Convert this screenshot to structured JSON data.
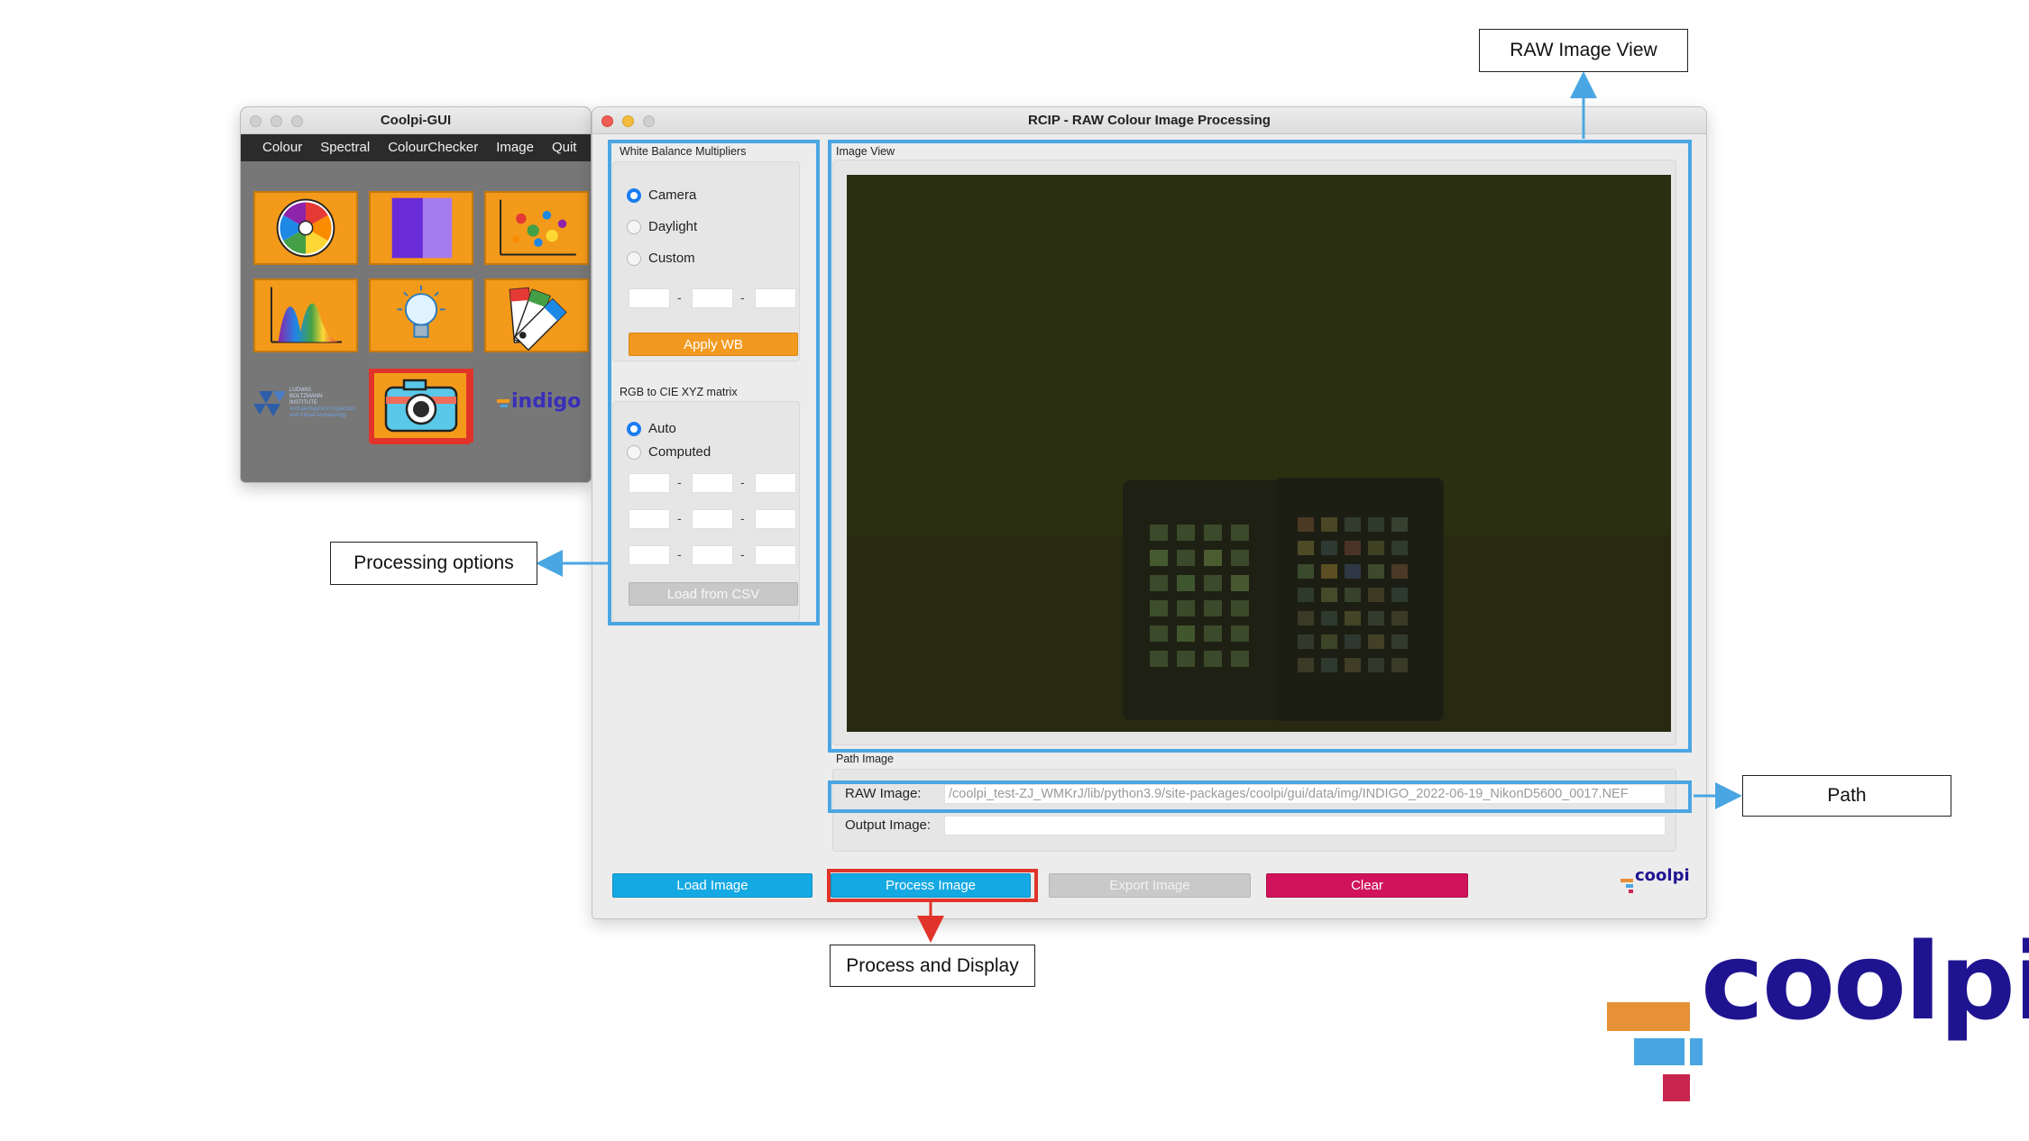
{
  "gui_window": {
    "title": "Coolpi-GUI",
    "menu": [
      "Colour",
      "Spectral",
      "ColourChecker",
      "Image",
      "Quit"
    ],
    "tiles": [
      {
        "name": "colour-wheel-icon"
      },
      {
        "name": "spectrum-bar-icon"
      },
      {
        "name": "scatter-plot-icon"
      },
      {
        "name": "spectral-curve-icon"
      },
      {
        "name": "light-bulb-icon"
      },
      {
        "name": "colour-swatch-fan-icon"
      },
      {
        "name": "camera-icon"
      }
    ],
    "lbi_logo_lines": [
      "LUDWIG",
      "BOLTZMANN",
      "INSTITUTE",
      "Archaeological Prospection",
      "and Virtual Archaeology"
    ],
    "indigo_logo": "indigo"
  },
  "rcip_window": {
    "title": "RCIP - RAW Colour Image Processing",
    "white_balance": {
      "group_title": "White Balance Multipliers",
      "options": [
        "Camera",
        "Daylight",
        "Custom"
      ],
      "selected": "Camera",
      "dash": "-",
      "apply_button": "Apply WB"
    },
    "matrix": {
      "group_title": "RGB to CIE XYZ matrix",
      "options": [
        "Auto",
        "Computed"
      ],
      "selected": "Auto",
      "dash": "-",
      "load_button": "Load from CSV"
    },
    "image_view": {
      "group_title": "Image View"
    },
    "path": {
      "group_title": "Path Image",
      "raw_label": "RAW Image:",
      "raw_value": "/coolpi_test-ZJ_WMKrJ/lib/python3.9/site-packages/coolpi/gui/data/img/INDIGO_2022-06-19_NikonD5600_0017.NEF",
      "output_label": "Output Image:",
      "output_value": ""
    },
    "buttons": {
      "load": "Load Image",
      "process": "Process Image",
      "export": "Export Image",
      "clear": "Clear"
    },
    "logo": "coolpi"
  },
  "annotations": {
    "raw_image_view": "RAW Image View",
    "processing_options": "Processing options",
    "path": "Path",
    "process_and_display": "Process and Display"
  },
  "brand_logo": "coolpi",
  "colors": {
    "highlight_blue": "#4aa6e2",
    "highlight_red": "#e0342a",
    "accent_orange": "#f29a1f",
    "button_blue": "#15a9e3",
    "button_clear": "#d0135a",
    "brand_navy": "#1f1490"
  }
}
